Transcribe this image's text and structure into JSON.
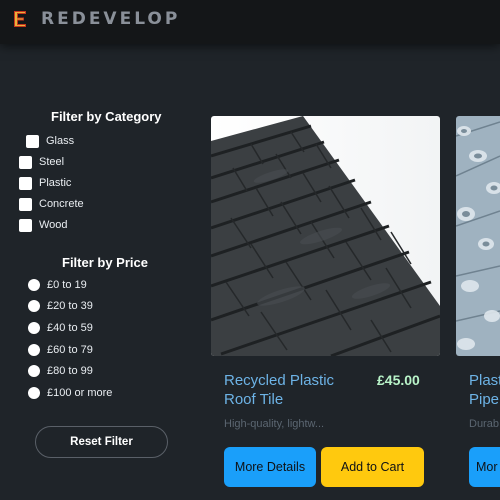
{
  "header": {
    "brand": "REDEVELOP",
    "logo_icon": "e-logo-icon"
  },
  "filters": {
    "category_title": "Filter by Category",
    "categories": [
      "Glass",
      "Steel",
      "Plastic",
      "Concrete",
      "Wood"
    ],
    "price_title": "Filter by Price",
    "prices": [
      "£0 to 19",
      "£20 to 39",
      "£40 to 59",
      "£60 to 79",
      "£80 to 99",
      "£100 or more"
    ],
    "reset_label": "Reset Filter"
  },
  "products": [
    {
      "title_line1": "Recycled Plastic",
      "title_line2": "Roof Tile",
      "price": "£45.00",
      "description": "High-quality, lightw...",
      "details_label": "More Details",
      "cart_label": "Add to Cart"
    },
    {
      "title_line1": "Plast",
      "title_line2": "Pipe",
      "description": "Durab",
      "details_label": "Mor"
    }
  ],
  "colors": {
    "accent_blue": "#1a9ffa",
    "accent_yellow": "#ffc90e",
    "price_green": "#b9f4c9",
    "title_blue": "#6db3e6"
  }
}
